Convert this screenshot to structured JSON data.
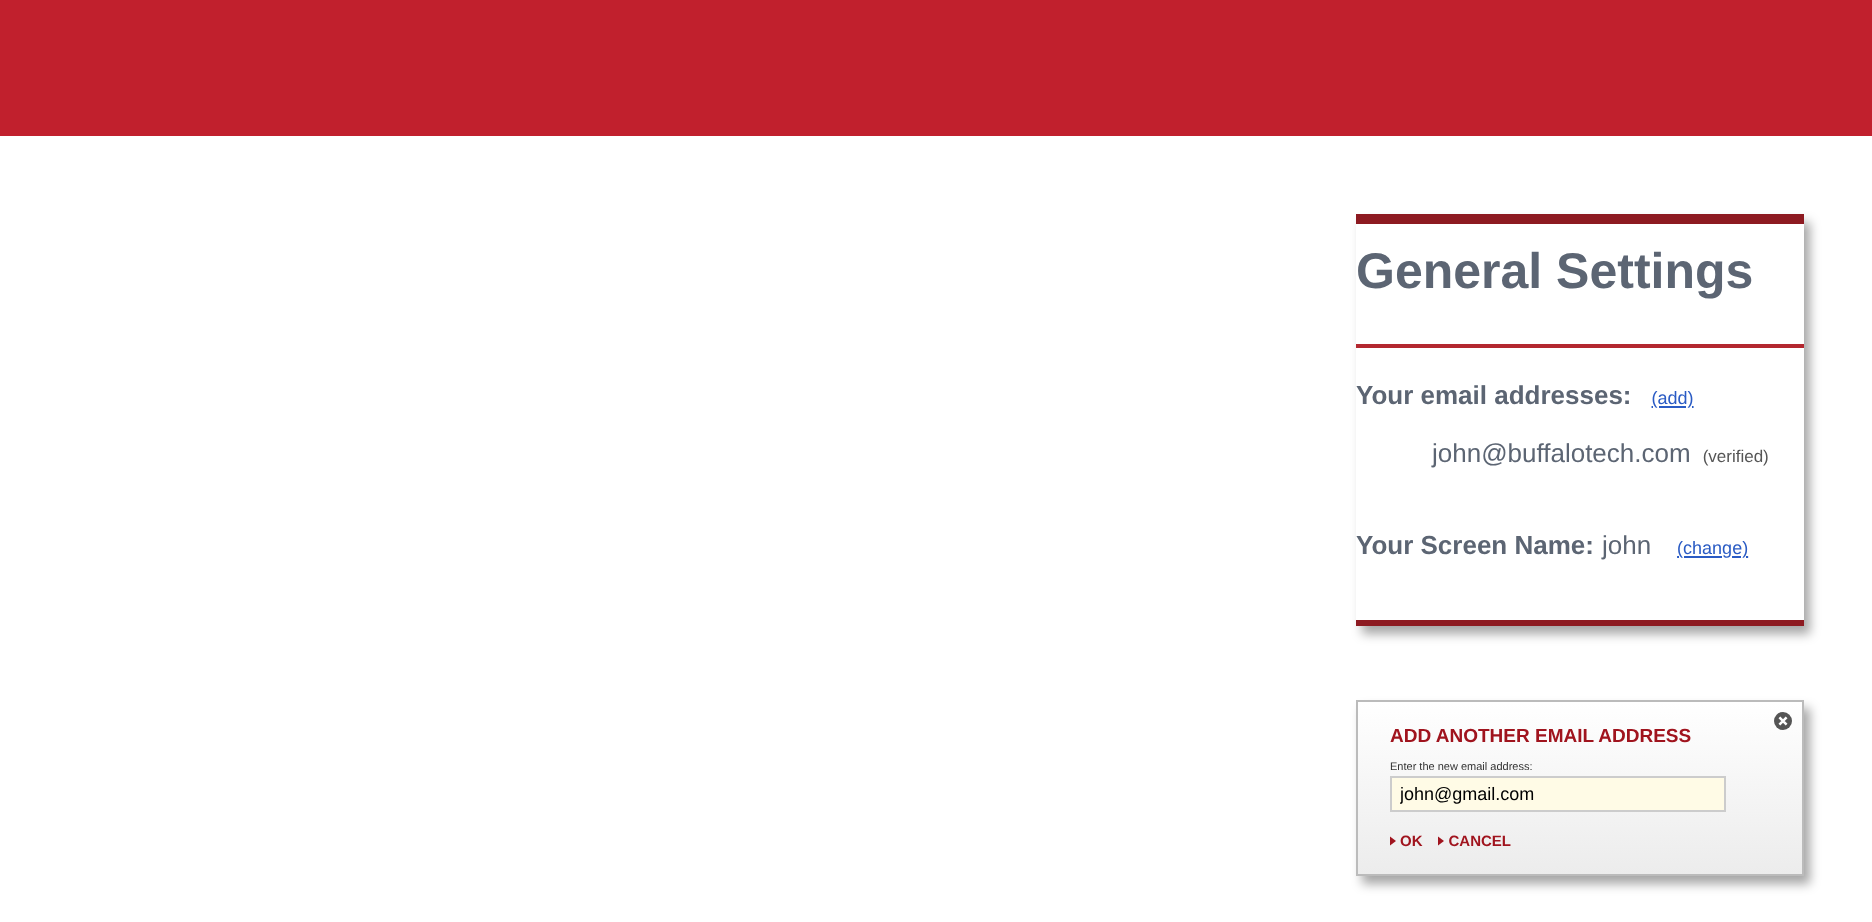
{
  "settings_panel": {
    "title": "General Settings",
    "email_label": "Your email addresses:",
    "add_link": "(add)",
    "emails": [
      {
        "address": "john@buffalotech.com",
        "status": "(verified)"
      }
    ],
    "screen_name_label": "Your Screen Name:",
    "screen_name": "john",
    "change_link": "(change)"
  },
  "dialog": {
    "title": "ADD ANOTHER EMAIL ADDRESS",
    "field_label": "Enter the new email address:",
    "value": "john@gmail.com",
    "actions": [
      "OK",
      "CANCEL"
    ]
  }
}
